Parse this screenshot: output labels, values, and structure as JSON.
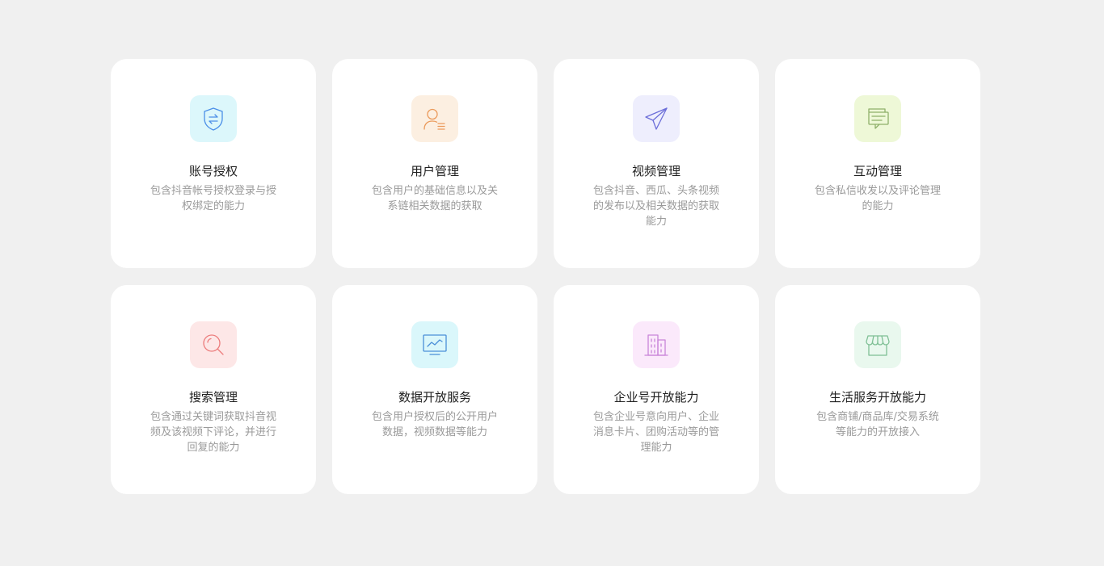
{
  "cards": [
    {
      "title": "账号授权",
      "desc": "包含抖音帐号授权登录与授权绑定的能力",
      "icon": "shield-swap-icon",
      "icon_bg": "#dcf7fb",
      "icon_color": "#4b8fe8"
    },
    {
      "title": "用户管理",
      "desc": "包含用户的基础信息以及关系链相关数据的获取",
      "icon": "user-list-icon",
      "icon_bg": "#fcefe1",
      "icon_color": "#eb9a5b"
    },
    {
      "title": "视频管理",
      "desc": "包含抖音、西瓜、头条视频的发布以及相关数据的获取能力",
      "icon": "paper-plane-icon",
      "icon_bg": "#eeeefd",
      "icon_color": "#6c6ed9"
    },
    {
      "title": "互动管理",
      "desc": "包含私信收发以及评论管理的能力",
      "icon": "chat-messages-icon",
      "icon_bg": "#eef8d7",
      "icon_color": "#8fb06a"
    },
    {
      "title": "搜索管理",
      "desc": "包含通过关键词获取抖音视频及该视频下评论，并进行回复的能力",
      "icon": "search-icon",
      "icon_bg": "#fde7e7",
      "icon_color": "#ec7c7c"
    },
    {
      "title": "数据开放服务",
      "desc": "包含用户授权后的公开用户数据，视频数据等能力",
      "icon": "monitor-chart-icon",
      "icon_bg": "#daf7fb",
      "icon_color": "#4b8fd8"
    },
    {
      "title": "企业号开放能力",
      "desc": "包含企业号意向用户、企业消息卡片、团购活动等的管理能力",
      "icon": "building-icon",
      "icon_bg": "#fbe9fb",
      "icon_color": "#c985d9"
    },
    {
      "title": "生活服务开放能力",
      "desc": "包含商铺/商品库/交易系统等能力的开放接入",
      "icon": "storefront-icon",
      "icon_bg": "#e9f8ee",
      "icon_color": "#7fbf95"
    }
  ]
}
